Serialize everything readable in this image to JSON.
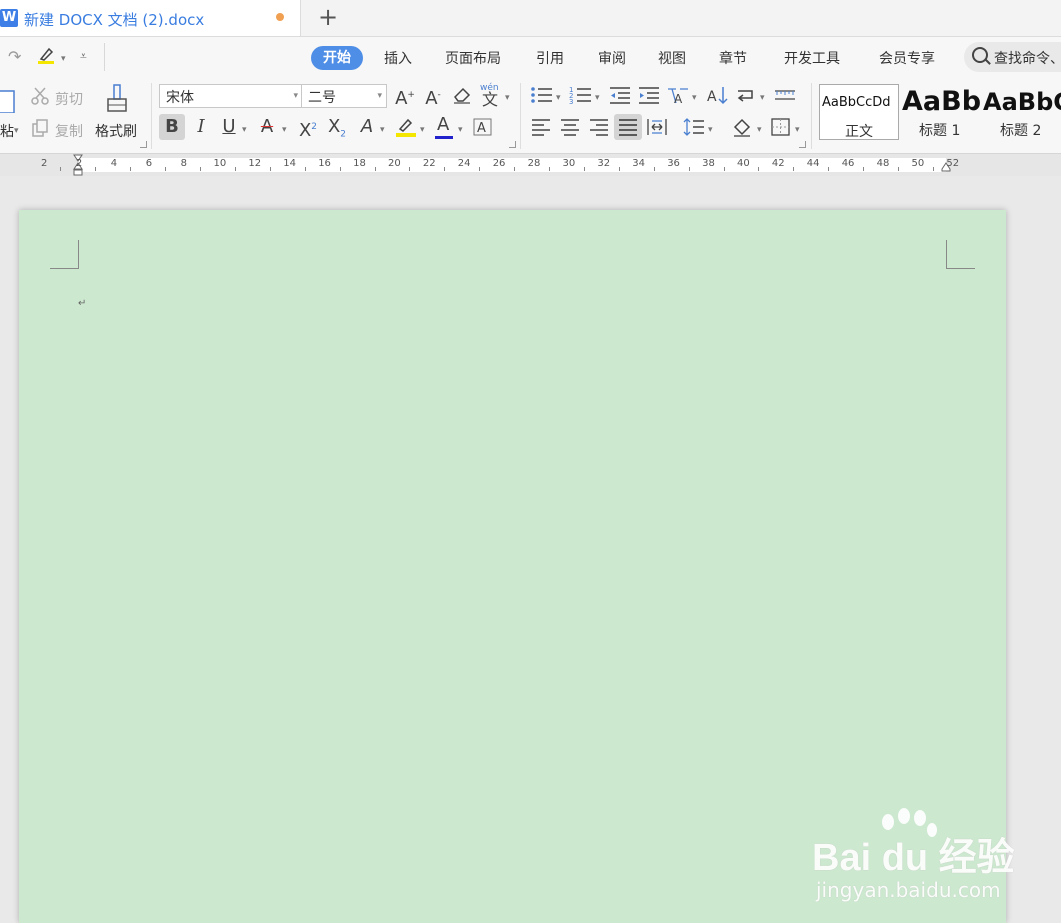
{
  "tab": {
    "title": "新建 DOCX 文档 (2).docx",
    "logo_letter": "W"
  },
  "menu": {
    "tabs": [
      "开始",
      "插入",
      "页面布局",
      "引用",
      "审阅",
      "视图",
      "章节",
      "开发工具",
      "会员专享"
    ],
    "active_index": 0,
    "search_placeholder": "查找命令、"
  },
  "ribbon": {
    "clipboard": {
      "paste_label": "粘",
      "cut_label": "剪切",
      "copy_label": "复制",
      "format_painter_label": "格式刷"
    },
    "font": {
      "family": "宋体",
      "size": "二号",
      "pinyin_glyph": "wén"
    },
    "styles": [
      {
        "sample": "AaBbCcDd",
        "name": "正文"
      },
      {
        "sample": "AaBb",
        "name": "标题 1"
      },
      {
        "sample": "AaBbC",
        "name": "标题 2"
      }
    ]
  },
  "ruler": {
    "numbers": [
      "2",
      "2",
      "4",
      "6",
      "8",
      "10",
      "12",
      "14",
      "16",
      "18",
      "20",
      "22",
      "24",
      "26",
      "28",
      "30",
      "32",
      "34",
      "36",
      "38",
      "40",
      "42",
      "44",
      "46",
      "48",
      "50",
      "52"
    ]
  },
  "document": {
    "paragraph_mark": "↵"
  },
  "watermark": {
    "brand": "Bai du 经验",
    "url": "jingyan.baidu.com"
  },
  "colors": {
    "accent": "#4f8ee6",
    "page_bg": "#cce8cf",
    "highlight_yellow": "#f5e600",
    "font_color_red": "#d33",
    "font_color_blue": "#2222cc"
  }
}
